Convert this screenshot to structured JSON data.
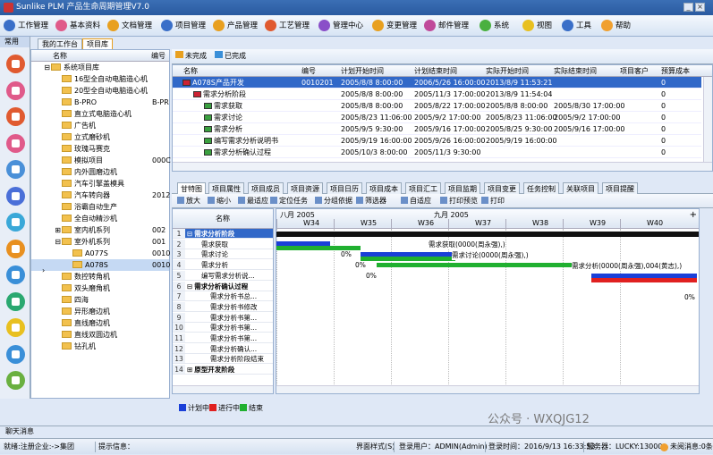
{
  "app": {
    "title": "Sunlike PLM 产品生命周期管理V7.0"
  },
  "toolbar": {
    "items": [
      {
        "label": "工作管理",
        "color": "#3a6fc8"
      },
      {
        "label": "基本资料",
        "color": "#e05a8a"
      },
      {
        "label": "文档管理",
        "color": "#e8a020"
      },
      {
        "label": "项目管理",
        "color": "#3a6fc8"
      },
      {
        "label": "产品管理",
        "color": "#e8a020"
      },
      {
        "label": "工艺管理",
        "color": "#e05a30"
      },
      {
        "label": "管理中心",
        "color": "#8a4fc8"
      },
      {
        "label": "变更管理",
        "color": "#e8a020"
      },
      {
        "label": "邮件管理",
        "color": "#c04a9a"
      },
      {
        "label": "系统",
        "color": "#4ab040"
      },
      {
        "label": "视图",
        "color": "#e8c020"
      },
      {
        "label": "工具",
        "color": "#3a6fc8"
      },
      {
        "label": "帮助",
        "color": "#f0a030"
      }
    ]
  },
  "leftnav": {
    "header": "常用",
    "icons": [
      {
        "name": "project-icon",
        "color": "#e05a30"
      },
      {
        "name": "calendar-icon",
        "color": "#e05a8a"
      },
      {
        "name": "doc-icon",
        "color": "#e05a30"
      },
      {
        "name": "gear-icon",
        "color": "#e05a8a"
      },
      {
        "name": "chart-icon",
        "color": "#4a90d8"
      },
      {
        "name": "list-icon",
        "color": "#4a6fd8"
      },
      {
        "name": "book-icon",
        "color": "#3aa8d8"
      },
      {
        "name": "box-icon",
        "color": "#e89020"
      },
      {
        "name": "tree-icon",
        "color": "#3a8fd8"
      },
      {
        "name": "report-icon",
        "color": "#2aa870"
      },
      {
        "name": "note-icon",
        "color": "#e8c020"
      },
      {
        "name": "org-icon",
        "color": "#3a8fd8"
      },
      {
        "name": "archive-icon",
        "color": "#6ab040"
      }
    ]
  },
  "tabs1": [
    "我的工作台",
    "项目库"
  ],
  "tree": {
    "headers": {
      "name": "名称",
      "code": "编号"
    },
    "rows": [
      {
        "label": "系统项目库",
        "code": "",
        "indent": 0,
        "exp": "⊟"
      },
      {
        "label": "16型全自动电脑造心机",
        "code": "",
        "indent": 1,
        "exp": ""
      },
      {
        "label": "20型全自动电脑造心机",
        "code": "",
        "indent": 1,
        "exp": ""
      },
      {
        "label": "B-PRO",
        "code": "B-PR",
        "indent": 1,
        "exp": ""
      },
      {
        "label": "直立式电脑造心机",
        "code": "",
        "indent": 1,
        "exp": ""
      },
      {
        "label": "广告机",
        "code": "",
        "indent": 1,
        "exp": ""
      },
      {
        "label": "立式磨砂机",
        "code": "",
        "indent": 1,
        "exp": ""
      },
      {
        "label": "玫瑰马赛克",
        "code": "",
        "indent": 1,
        "exp": ""
      },
      {
        "label": "模拟项目",
        "code": "000C",
        "indent": 1,
        "exp": ""
      },
      {
        "label": "内外圆磨边机",
        "code": "",
        "indent": 1,
        "exp": ""
      },
      {
        "label": "汽车引擎盖模具",
        "code": "",
        "indent": 1,
        "exp": ""
      },
      {
        "label": "汽车转向器",
        "code": "2012",
        "indent": 1,
        "exp": ""
      },
      {
        "label": "浴霸自动生产",
        "code": "",
        "indent": 1,
        "exp": ""
      },
      {
        "label": "全自动精沙机",
        "code": "",
        "indent": 1,
        "exp": ""
      },
      {
        "label": "室内机系列",
        "code": "002",
        "indent": 1,
        "exp": "⊞"
      },
      {
        "label": "室外机系列",
        "code": "001",
        "indent": 1,
        "exp": "⊟"
      },
      {
        "label": "A077S",
        "code": "0010",
        "indent": 2,
        "exp": ""
      },
      {
        "label": "A078S",
        "code": "0010",
        "indent": 2,
        "exp": "",
        "selected": true
      },
      {
        "label": "数控转角机",
        "code": "",
        "indent": 1,
        "exp": ""
      },
      {
        "label": "双头磨角机",
        "code": "",
        "indent": 1,
        "exp": ""
      },
      {
        "label": "四海",
        "code": "",
        "indent": 1,
        "exp": ""
      },
      {
        "label": "异形磨边机",
        "code": "",
        "indent": 1,
        "exp": ""
      },
      {
        "label": "直线磨边机",
        "code": "",
        "indent": 1,
        "exp": ""
      },
      {
        "label": "直线双圆边机",
        "code": "",
        "indent": 1,
        "exp": ""
      },
      {
        "label": "钻孔机",
        "code": "",
        "indent": 1,
        "exp": ""
      }
    ]
  },
  "rtoolbar": {
    "unfinished": "未完成",
    "finished": "已完成"
  },
  "grid": {
    "headers": [
      "名称",
      "编号",
      "计划开始时间",
      "计划结束时间",
      "实际开始时间",
      "实际结束时间",
      "项目客户",
      "预算成本"
    ],
    "rows": [
      {
        "name": "A078S产品开发",
        "code": "0010201",
        "ps": "2005/8/8 8:00:00",
        "pe": "2006/5/26 16:00:00",
        "as": "2013/8/9 11:53:21",
        "ae": "",
        "cust": "",
        "cost": "0",
        "indent": 0,
        "selected": true
      },
      {
        "name": "需求分析阶段",
        "code": "",
        "ps": "2005/8/8 8:00:00",
        "pe": "2005/11/3 17:00:00",
        "as": "2013/8/9 11:54:04",
        "ae": "",
        "cust": "",
        "cost": "0",
        "indent": 1
      },
      {
        "name": "需求获取",
        "code": "",
        "ps": "2005/8/8 8:00:00",
        "pe": "2005/8/22 17:00:00",
        "as": "2005/8/8 8:00:00",
        "ae": "2005/8/30 17:00:00",
        "cust": "",
        "cost": "0",
        "indent": 2
      },
      {
        "name": "需求讨论",
        "code": "",
        "ps": "2005/8/23 11:06:00",
        "pe": "2005/9/2 17:00:00",
        "as": "2005/8/23 11:06:00",
        "ae": "2005/9/2 17:00:00",
        "cust": "",
        "cost": "0",
        "indent": 2
      },
      {
        "name": "需求分析",
        "code": "",
        "ps": "2005/9/5 9:30:00",
        "pe": "2005/9/16 17:00:00",
        "as": "2005/8/25 9:30:00",
        "ae": "2005/9/16 17:00:00",
        "cust": "",
        "cost": "0",
        "indent": 2
      },
      {
        "name": "编写需求分析说明书",
        "code": "",
        "ps": "2005/9/19 16:00:00",
        "pe": "2005/9/26 16:00:00",
        "as": "2005/9/19 16:00:00",
        "ae": "",
        "cust": "",
        "cost": "0",
        "indent": 2
      },
      {
        "name": "需求分析确认过程",
        "code": "",
        "ps": "2005/10/3 8:00:00",
        "pe": "2005/11/3 9:30:00",
        "as": "",
        "ae": "",
        "cust": "",
        "cost": "0",
        "indent": 2
      }
    ]
  },
  "tabs2": [
    "甘特图",
    "项目属性",
    "项目成员",
    "项目资源",
    "项目日历",
    "项目成本",
    "项目汇工",
    "项目监期",
    "项目变更",
    "任务控制",
    "关联项目",
    "项目提醒"
  ],
  "gantt_toolbar": [
    "放大",
    "缩小",
    "最适应",
    "定位任务",
    "分组依据",
    "筛选器",
    "自适应",
    "打印预览",
    "打印"
  ],
  "gantt": {
    "name_header": "名称",
    "months": [
      "八月 2005",
      "九月 2005"
    ],
    "weeks": [
      "W34",
      "W35",
      "W36",
      "W37",
      "W38",
      "W39",
      "W40"
    ],
    "rows": [
      {
        "n": "1",
        "label": "需求分析阶段",
        "bold": true,
        "exp": "⊟"
      },
      {
        "n": "2",
        "label": "需求获取",
        "bold": false
      },
      {
        "n": "3",
        "label": "需求讨论",
        "bold": false
      },
      {
        "n": "4",
        "label": "需求分析",
        "bold": false
      },
      {
        "n": "5",
        "label": "编写需求分析说...",
        "bold": false
      },
      {
        "n": "6",
        "label": "需求分析确认过程",
        "bold": true,
        "exp": "⊟"
      },
      {
        "n": "7",
        "label": "需求分析书总...",
        "bold": false
      },
      {
        "n": "8",
        "label": "需求分析书修改",
        "bold": false
      },
      {
        "n": "9",
        "label": "需求分析书第...",
        "bold": false
      },
      {
        "n": "10",
        "label": "需求分析书第...",
        "bold": false
      },
      {
        "n": "11",
        "label": "需求分析书第...",
        "bold": false
      },
      {
        "n": "12",
        "label": "需求分析确认...",
        "bold": false
      },
      {
        "n": "13",
        "label": "需求分析阶段结束",
        "bold": false
      },
      {
        "n": "14",
        "label": "原型开发阶段",
        "bold": true,
        "exp": "⊞"
      }
    ],
    "bar_labels": [
      "需求获取(0000(周永强),)",
      "需求讨论(0000(周永强),)",
      "需求分析(0000(周永强),004(黄志),)"
    ],
    "pct": [
      "0%",
      "0%",
      "0%",
      "0%"
    ]
  },
  "legend": [
    {
      "label": "计划中",
      "color": "#1a3fd8"
    },
    {
      "label": "进行中",
      "color": "#e02020"
    },
    {
      "label": "结束",
      "color": "#20b030"
    }
  ],
  "bottomtab": "聊天消息",
  "watermark": "公众号 · WXQJG12",
  "status": {
    "company": "就绪:注册企业:->集团",
    "tip": "提示信息：",
    "style": "界面样式(S)",
    "user": "登录用户：ADMIN(Admin)",
    "time": "登录时间：2016/9/13 16:33:53",
    "server": "服务器：LUCKY:13000",
    "msg": "未阅消息:0条"
  }
}
